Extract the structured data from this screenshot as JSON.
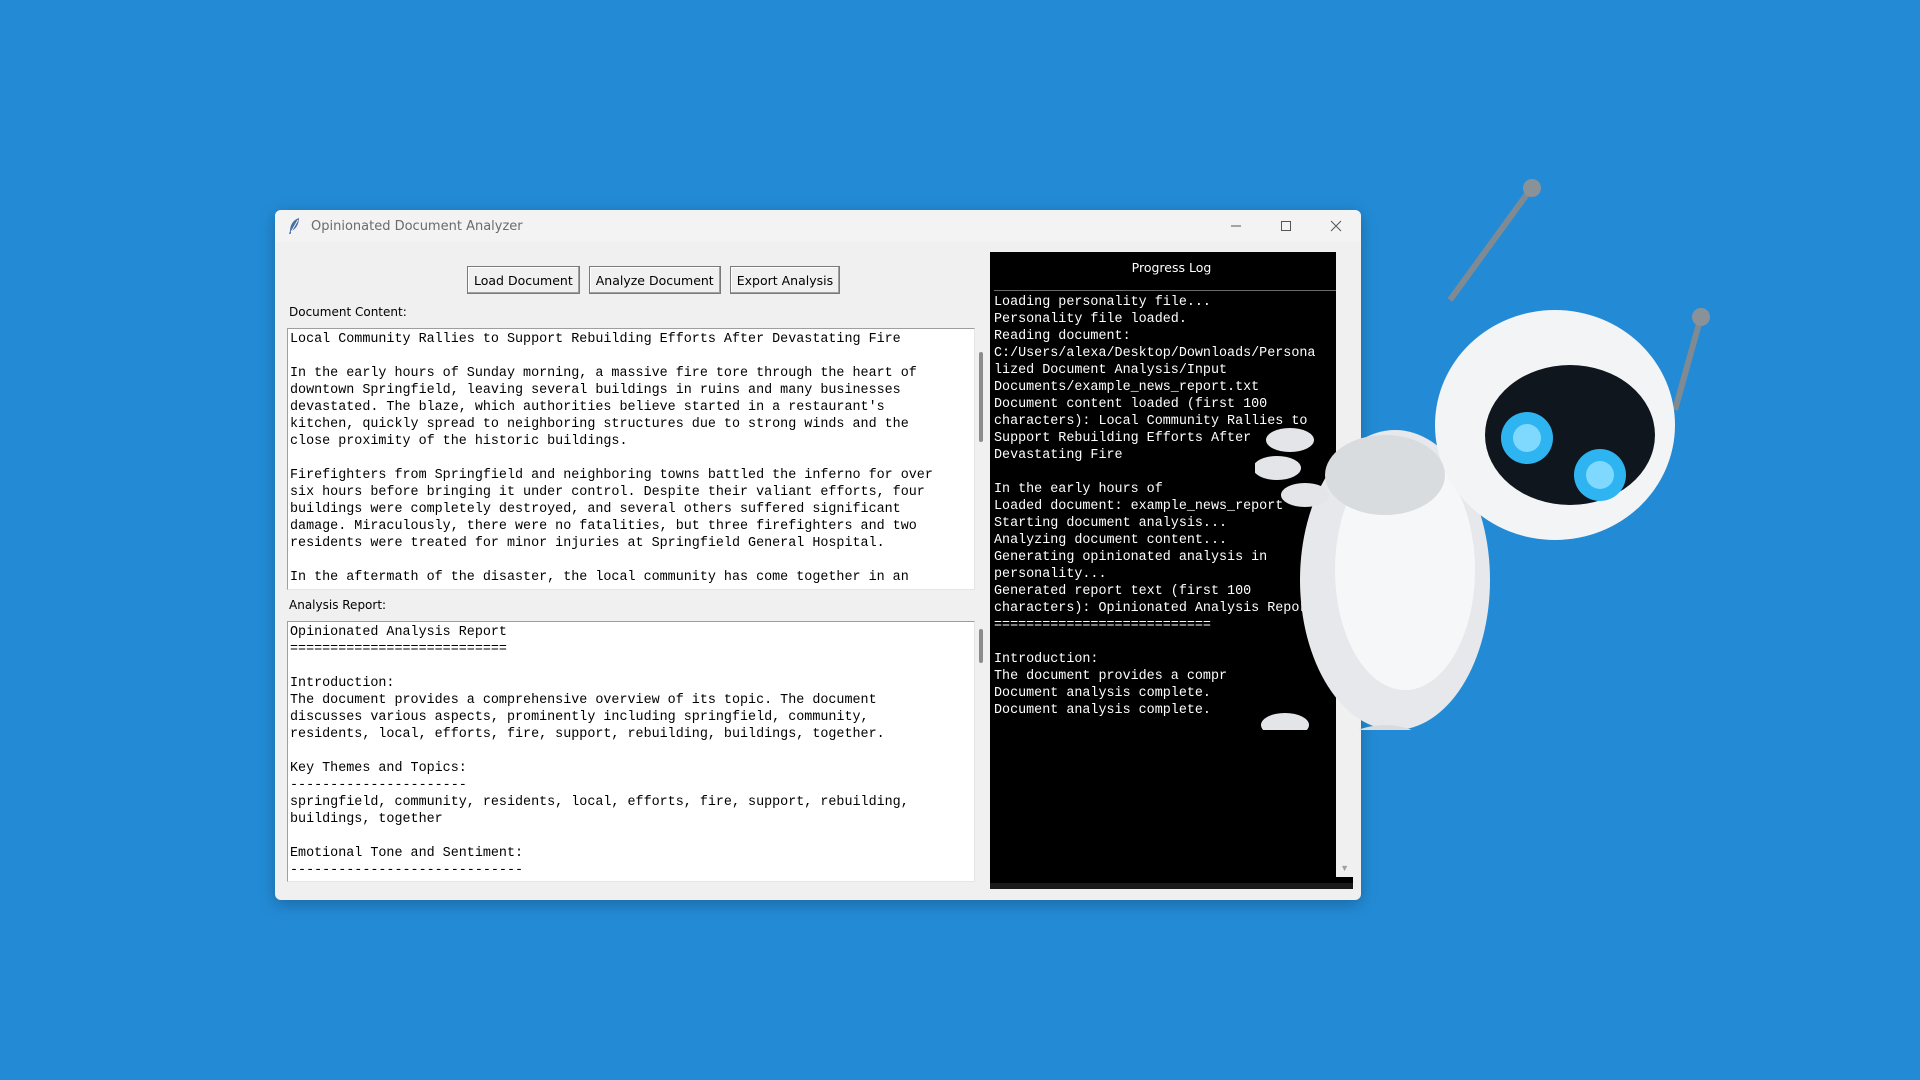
{
  "window": {
    "title": "Opinionated Document Analyzer"
  },
  "toolbar": {
    "load_label": "Load Document",
    "analyze_label": "Analyze Document",
    "export_label": "Export Analysis"
  },
  "document": {
    "label": "Document Content:",
    "content": "Local Community Rallies to Support Rebuilding Efforts After Devastating Fire\n\nIn the early hours of Sunday morning, a massive fire tore through the heart of\ndowntown Springfield, leaving several buildings in ruins and many businesses\ndevastated. The blaze, which authorities believe started in a restaurant's\nkitchen, quickly spread to neighboring structures due to strong winds and the\nclose proximity of the historic buildings.\n\nFirefighters from Springfield and neighboring towns battled the inferno for over\nsix hours before bringing it under control. Despite their valiant efforts, four\nbuildings were completely destroyed, and several others suffered significant\ndamage. Miraculously, there were no fatalities, but three firefighters and two\nresidents were treated for minor injuries at Springfield General Hospital.\n\nIn the aftermath of the disaster, the local community has come together in an"
  },
  "report": {
    "label": "Analysis Report:",
    "content": "Opinionated Analysis Report\n===========================\n\nIntroduction:\nThe document provides a comprehensive overview of its topic. The document\ndiscusses various aspects, prominently including springfield, community,\nresidents, local, efforts, fire, support, rebuilding, buildings, together.\n\nKey Themes and Topics:\n----------------------\nspringfield, community, residents, local, efforts, fire, support, rebuilding,\nbuildings, together\n\nEmotional Tone and Sentiment:\n-----------------------------"
  },
  "progress_log": {
    "title": "Progress Log",
    "content": "Loading personality file...\nPersonality file loaded.\nReading document:\nC:/Users/alexa/Desktop/Downloads/Persona\nlized Document Analysis/Input\nDocuments/example_news_report.txt\nDocument content loaded (first 100\ncharacters): Local Community Rallies to\nSupport Rebuilding Efforts After\nDevastating Fire\n\nIn the early hours of\nLoaded document: example_news_report\nStarting document analysis...\nAnalyzing document content...\nGenerating opinionated analysis in\npersonality...\nGenerated report text (first 100\ncharacters): Opinionated Analysis Report\n===========================\n\nIntroduction:\nThe document provides a compr\nDocument analysis complete.\nDocument analysis complete."
  },
  "icons": {
    "app": "feather-icon",
    "minimize": "minimize-icon",
    "maximize": "maximize-icon",
    "close": "close-icon"
  },
  "colors": {
    "background": "#238bd6",
    "log_background": "#000000",
    "log_text": "#ffffff"
  }
}
